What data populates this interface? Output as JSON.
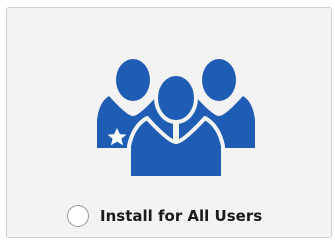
{
  "install_option": {
    "label": "Install for All Users",
    "selected": false,
    "icon": "users-group-icon",
    "badge_icon": "star-icon",
    "colors": {
      "icon": "#1f5db5",
      "badge": "#ffffff",
      "card_background": "#f3f3f3",
      "card_border": "#cfcfcf"
    }
  }
}
